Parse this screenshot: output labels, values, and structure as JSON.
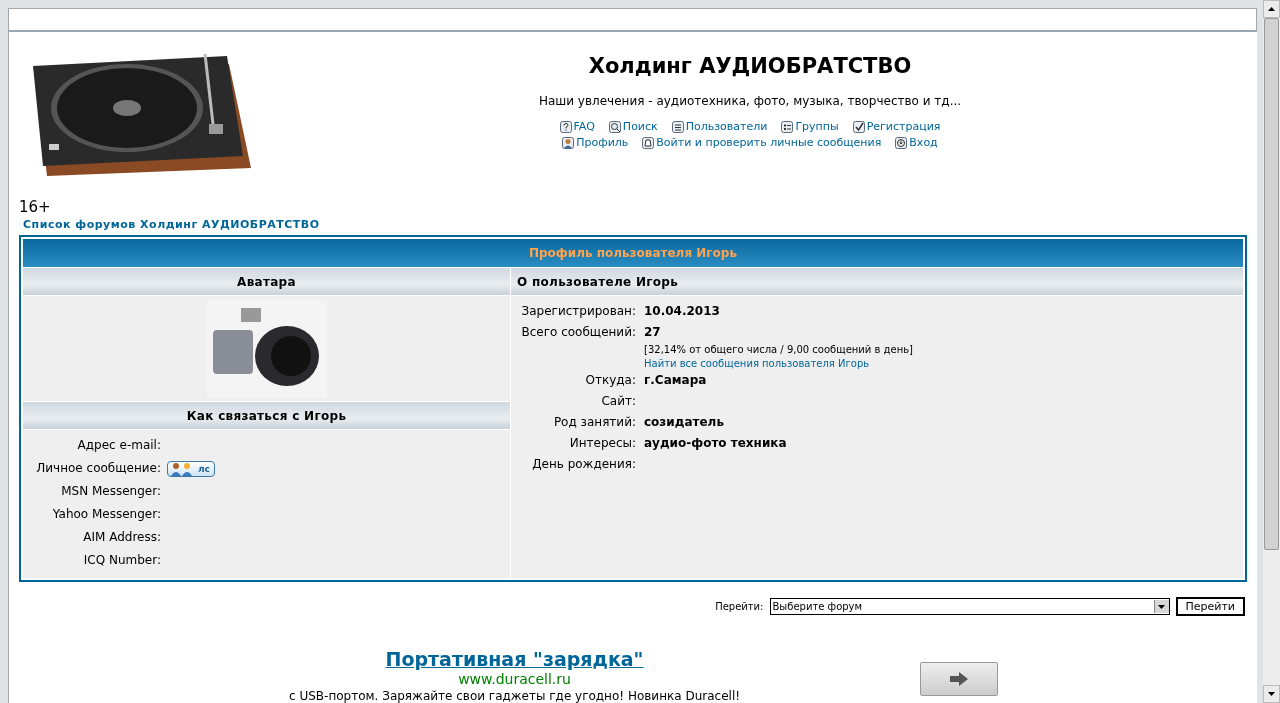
{
  "site": {
    "title": "Холдинг АУДИОБРАТСТВО",
    "tagline": "Наши увлечения - аудиотехника, фото, музыка, творчество и тд...",
    "nav_rows": [
      [
        {
          "label": "FAQ",
          "kind": "help"
        },
        {
          "label": "Поиск",
          "kind": "search"
        },
        {
          "label": "Пользователи",
          "kind": "list"
        },
        {
          "label": "Группы",
          "kind": "groups"
        },
        {
          "label": "Регистрация",
          "kind": "check"
        }
      ],
      [
        {
          "label": "Профиль",
          "kind": "user"
        },
        {
          "label": "Войти и проверить личные сообщения",
          "kind": "mail"
        },
        {
          "label": "Вход",
          "kind": "login"
        }
      ]
    ]
  },
  "age_rating": "16+",
  "breadcrumb": "Список форумов Холдинг АУДИОБРАТСТВО",
  "profile": {
    "title": "Профиль пользователя Игорь",
    "avatar_header": "Аватара",
    "about_header": "О пользователе Игорь",
    "contact_header": "Как связаться с Игорь",
    "contacts": [
      {
        "label": "Адрес e-mail:",
        "kind": "empty"
      },
      {
        "label": "Личное сообщение:",
        "kind": "pm",
        "button": "лс"
      },
      {
        "label": "MSN Messenger:",
        "kind": "empty"
      },
      {
        "label": "Yahoo Messenger:",
        "kind": "empty"
      },
      {
        "label": "AIM Address:",
        "kind": "empty"
      },
      {
        "label": "ICQ Number:",
        "kind": "empty"
      }
    ],
    "details": [
      {
        "label": "Зарегистрирован:",
        "value": "10.04.2013"
      },
      {
        "label": "Всего сообщений:",
        "value": "27",
        "note": "[32,14% от общего числа / 9,00 сообщений в день]",
        "link": "Найти все сообщения пользователя Игорь"
      },
      {
        "label": "Откуда:",
        "value": "г.Самара"
      },
      {
        "label": "Сайт:"
      },
      {
        "label": "Род занятий:",
        "value": "созидатель"
      },
      {
        "label": "Интересы:",
        "value": "аудио-фото техника"
      },
      {
        "label": "День рождения:"
      }
    ]
  },
  "jump": {
    "label": "Перейти:",
    "select": "Выберите форум",
    "button": "Перейти"
  },
  "ad": {
    "title": "Портативная \"зарядка\"",
    "url": "www.duracell.ru",
    "text": "с USB-портом. Заряжайте свои гаджеты где угодно! Новинка Duracell!"
  }
}
